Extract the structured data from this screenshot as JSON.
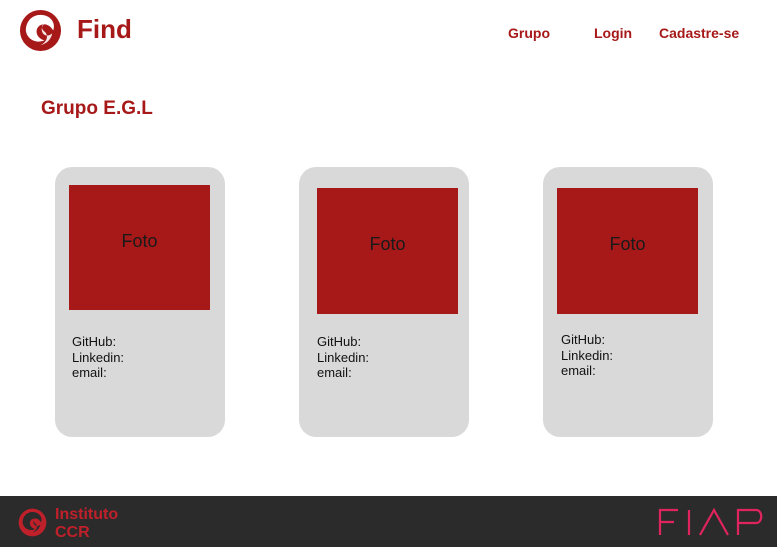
{
  "header": {
    "brand": "Find",
    "nav": [
      {
        "label": "Grupo"
      },
      {
        "label": "Login"
      },
      {
        "label": "Cadastre-se"
      }
    ]
  },
  "page": {
    "title": "Grupo E.G.L"
  },
  "cards": [
    {
      "photo_label": "Foto",
      "fields": [
        "GitHub:",
        "Linkedin:",
        "email:"
      ]
    },
    {
      "photo_label": "Foto",
      "fields": [
        "GitHub:",
        "Linkedin:",
        "email:"
      ]
    },
    {
      "photo_label": "Foto",
      "fields": [
        "GitHub:",
        "Linkedin:",
        "email:"
      ]
    }
  ],
  "footer": {
    "org_line1": "Instituto",
    "org_line2": "CCR",
    "partner_logo": "FIAP"
  },
  "colors": {
    "brand_red": "#a71919",
    "card_bg": "#d9d9d9",
    "footer_bg": "#2b2b2b",
    "footer_accent": "#c0202a"
  },
  "icons": {
    "header_logo": "swirl-logo-icon",
    "footer_logo": "swirl-logo-icon",
    "partner": "fiap-logo"
  }
}
